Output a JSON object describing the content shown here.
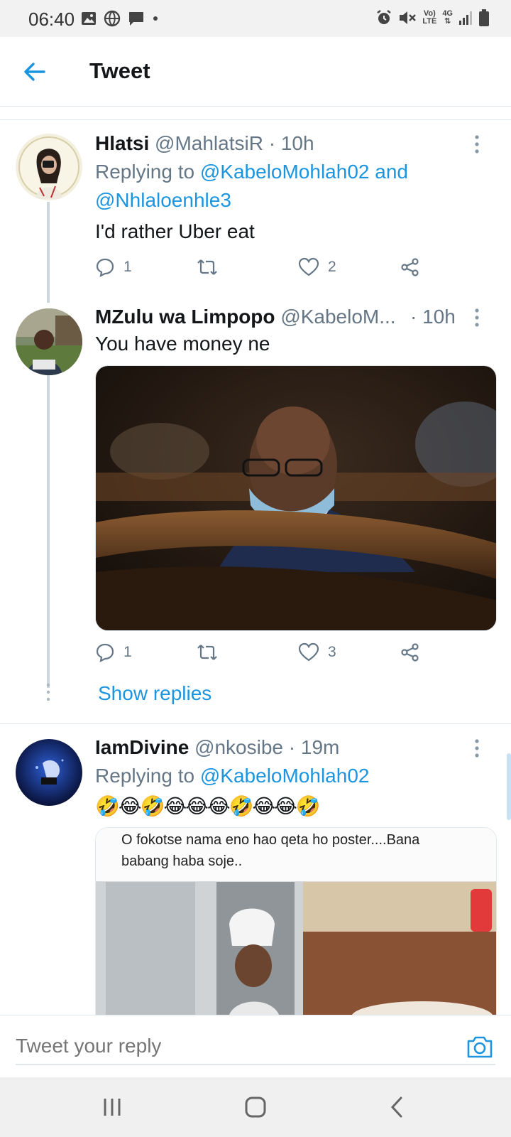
{
  "status_bar": {
    "time": "06:40",
    "net_top": "Vo)",
    "net_bottom": "LTE",
    "net_gen": "4G"
  },
  "header": {
    "title": "Tweet"
  },
  "tweets": [
    {
      "name": "Hlatsi",
      "handle": "@MahlatsiR",
      "time": "· 10h",
      "replying_prefix": "Replying to ",
      "replying_to": "@KabeloMohlah02 and",
      "replying_to_2": "@Nhlaloenhle3",
      "text": "I'd rather Uber eat",
      "replies": "1",
      "likes": "2"
    },
    {
      "name": "MZulu wa Limpopo",
      "handle": "@KabeloM...",
      "time": "· 10h",
      "text": "You have money ne",
      "replies": "1",
      "likes": "3",
      "show_replies": "Show replies"
    },
    {
      "name": "IamDivine",
      "handle": "@nkosibe",
      "time": "· 19m",
      "replying_prefix": "Replying to ",
      "replying_to": "@KabeloMohlah02",
      "emoji_text": "🤣😂🤣😂😂😂🤣😂😂🤣",
      "media_caption_1": "O fokotse nama eno hao qeta ho poster....Bana",
      "media_caption_2": "babang haba soje.."
    }
  ],
  "reply_bar": {
    "placeholder": "Tweet your reply"
  },
  "colors": {
    "link": "#1b95e0",
    "muted": "#657786",
    "text": "#14171a"
  }
}
